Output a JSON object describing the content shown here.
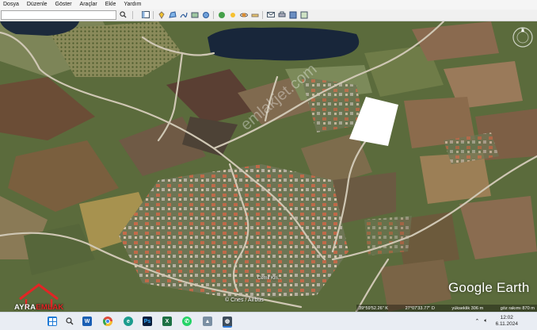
{
  "menu": [
    "Dosya",
    "Düzenle",
    "Göster",
    "Araçlar",
    "Ekle",
    "Yardım"
  ],
  "search": {
    "value": ""
  },
  "map": {
    "logo": "Google Earth",
    "watermark": "emlakjet.com",
    "image_credit": "© Cnes / Airbus",
    "road_label": "Cemil Kiri...",
    "status": {
      "lat": "39°59'52.26\" K",
      "lon": "27°07'33.77\" D",
      "elevation": "yükseklik  306 m",
      "eye": "göz rakımı  870 m"
    }
  },
  "brand": {
    "part1": "AYRA",
    "part2": "EMLAK"
  },
  "taskbar": {
    "time": "12:02",
    "date": "6.11.2024",
    "icons": [
      "windows-start-icon",
      "search-icon",
      "explorer-icon",
      "word-icon",
      "chrome-icon",
      "edge-icon",
      "photoshop-icon",
      "excel-icon",
      "whatsapp-icon",
      "app-icon",
      "google-earth-icon"
    ]
  },
  "colors": {
    "highlight_parcel": "#ffffff",
    "brand_red": "#e32525",
    "toolbar_accent": "#2d5f9e"
  }
}
